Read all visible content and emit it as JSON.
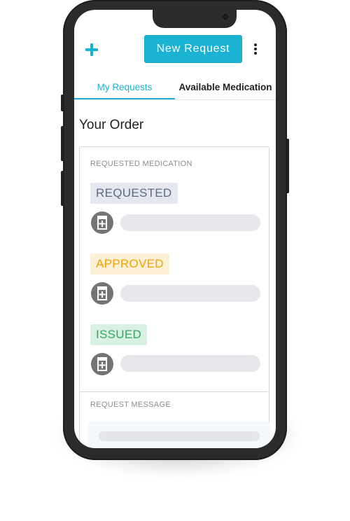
{
  "header": {
    "new_request_label": "New Request",
    "add_icon": "plus-icon",
    "more_icon": "more-vertical-icon",
    "accent_color": "#1ab3d3"
  },
  "tabs": [
    {
      "label": "My Requests",
      "active": true
    },
    {
      "label": "Available Medication",
      "active": false
    }
  ],
  "page_title": "Your Order",
  "requested_medication": {
    "section_label": "REQUESTED MEDICATION",
    "items": [
      {
        "status": "REQUESTED",
        "status_color": "#5c6b85",
        "icon": "medicine-bottle-icon"
      },
      {
        "status": "APPROVED",
        "status_color": "#f4a100",
        "icon": "medicine-bottle-icon"
      },
      {
        "status": "ISSUED",
        "status_color": "#2fa862",
        "icon": "medicine-bottle-icon"
      }
    ]
  },
  "request_message": {
    "section_label": "REQUEST MESSAGE"
  }
}
